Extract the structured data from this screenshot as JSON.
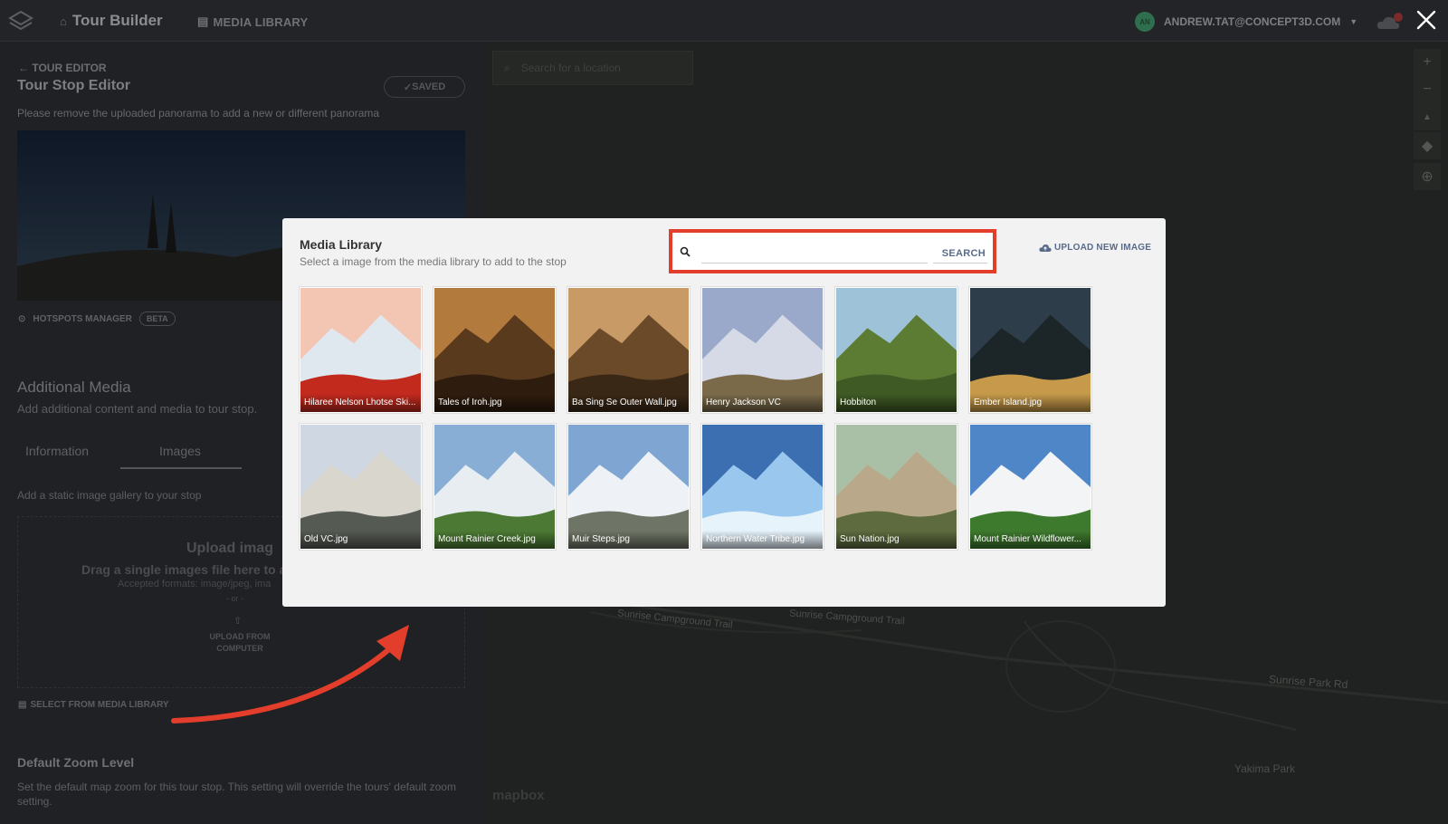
{
  "topbar": {
    "app_title": "Tour Builder",
    "media_library_link": "MEDIA LIBRARY",
    "user_email": "ANDREW.TAT@CONCEPT3D.COM",
    "avatar_initials": "AN"
  },
  "editor": {
    "back_label": "TOUR EDITOR",
    "title": "Tour Stop Editor",
    "saved_label": "SAVED",
    "panorama_note": "Please remove the uploaded panorama to add a new or different panorama",
    "hotspots_label": "HOTSPOTS MANAGER",
    "beta_label": "BETA",
    "additional_media_title": "Additional Media",
    "additional_media_sub": "Add additional content and media to tour stop.",
    "tabs": [
      {
        "label": "Information"
      },
      {
        "label": "Images"
      }
    ],
    "gallery_note": "Add a static image gallery to your stop",
    "upload_title": "Upload imag",
    "upload_drag": "Drag a single images file here to a",
    "upload_formats": "Accepted formats: image/jpeg, ima",
    "upload_or": "- or -",
    "upload_button": "UPLOAD FROM COMPUTER",
    "select_media_label": "SELECT FROM MEDIA LIBRARY",
    "zoom_title": "Default Zoom Level",
    "zoom_note": "Set the default map zoom for this tour stop. This setting will override the tours' default zoom setting."
  },
  "map": {
    "search_placeholder": "Search for a location",
    "labels": [
      {
        "text": "Sunrise Campground Trail"
      },
      {
        "text": "Sunrise Campground Trail"
      },
      {
        "text": "Sunrise Park Rd"
      },
      {
        "text": "Yakima Park"
      }
    ],
    "brand": "mapbox"
  },
  "modal": {
    "title": "Media Library",
    "subtitle": "Select a image from the media library to add to the stop",
    "search_value": "",
    "search_button": "SEARCH",
    "upload_new_label": "UPLOAD NEW IMAGE",
    "images": [
      {
        "name": "Hilaree Nelson Lhotse Ski...",
        "palette": [
          "#f3c6b4",
          "#dfe7ef",
          "#c22a1e"
        ]
      },
      {
        "name": "Tales of Iroh.jpg",
        "palette": [
          "#b27a3c",
          "#5a3a1c",
          "#2e1c0e"
        ]
      },
      {
        "name": "Ba Sing Se Outer Wall.jpg",
        "palette": [
          "#c89a66",
          "#6b4a2a",
          "#3a2816"
        ]
      },
      {
        "name": "Henry Jackson VC",
        "palette": [
          "#9aa9c9",
          "#d6dae6",
          "#7a6a4a"
        ]
      },
      {
        "name": "Hobbiton",
        "palette": [
          "#9ec3d8",
          "#5d7c33",
          "#3f5a24"
        ]
      },
      {
        "name": "Ember Island.jpg",
        "palette": [
          "#2d3e4a",
          "#1c2628",
          "#c69a4a"
        ]
      },
      {
        "name": "Old VC.jpg",
        "palette": [
          "#cfd8e2",
          "#d9d6cd",
          "#555a52"
        ]
      },
      {
        "name": "Mount Rainier Creek.jpg",
        "palette": [
          "#88aed6",
          "#e8edf2",
          "#4c7a34"
        ]
      },
      {
        "name": "Muir Steps.jpg",
        "palette": [
          "#7fa6d2",
          "#eef2f6",
          "#6f7566"
        ]
      },
      {
        "name": "Northern Water Tribe.jpg",
        "palette": [
          "#3b6fb2",
          "#9ac7ee",
          "#e6f3fb"
        ]
      },
      {
        "name": "Sun Nation.jpg",
        "palette": [
          "#a9bfa6",
          "#b9a98a",
          "#5d6b3e"
        ]
      },
      {
        "name": "Mount Rainier Wildflower...",
        "palette": [
          "#4e86c8",
          "#f2f4f6",
          "#3e7a2e"
        ]
      }
    ]
  }
}
